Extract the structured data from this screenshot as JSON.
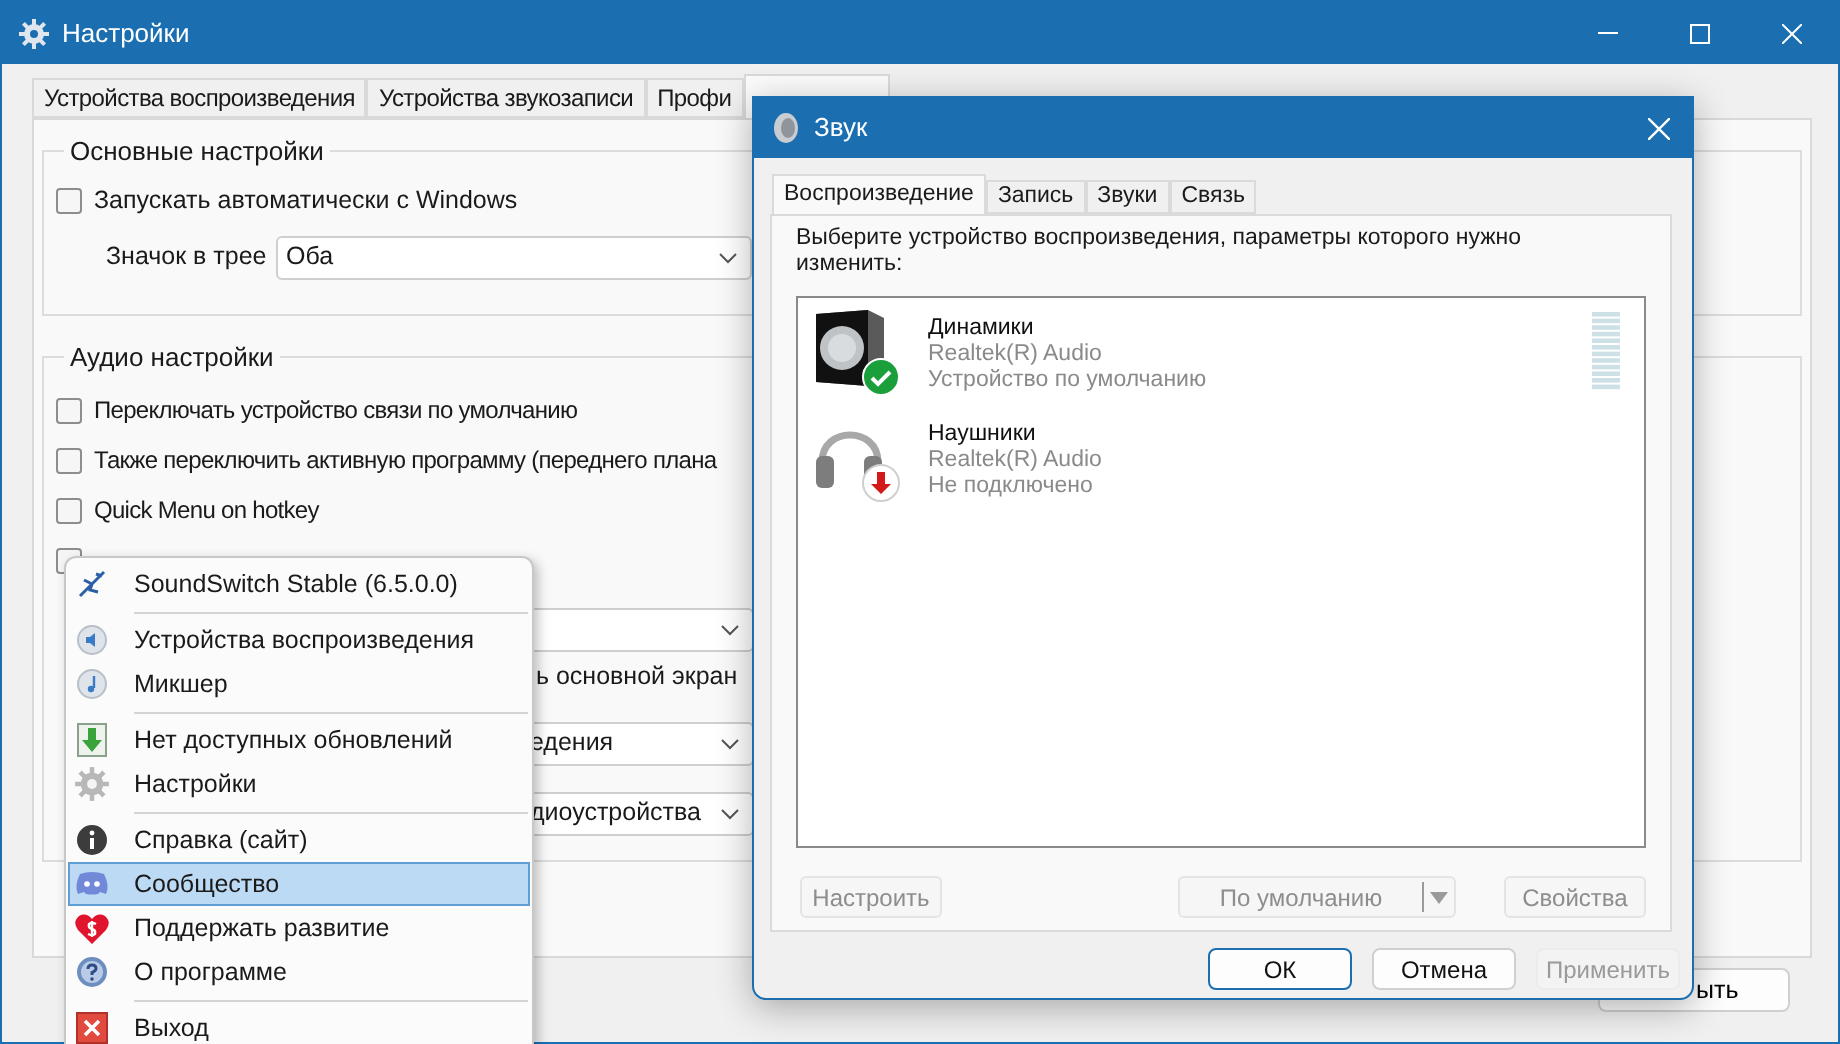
{
  "settings_window": {
    "title": "Настройки",
    "tabs": [
      {
        "label": "Устройства воспроизведения",
        "selected": false
      },
      {
        "label": "Устройства звукозаписи",
        "selected": false
      },
      {
        "label": "Профи",
        "selected": false
      },
      {
        "selected": true
      }
    ],
    "general_group": {
      "title": "Основные настройки",
      "autostart": {
        "label": "Запускать автоматически с Windows",
        "checked": false
      },
      "tray_icon": {
        "label": "Значок в трее",
        "value": "Оба"
      }
    },
    "audio_group": {
      "title": "Аудио настройки",
      "options": [
        {
          "kind": "checkbox",
          "label": "Переключать устройство связи по умолчанию",
          "checked": false
        },
        {
          "kind": "checkbox",
          "label": "Также переключить активную программу (переднего плана",
          "checked": false
        },
        {
          "kind": "checkbox",
          "label": "Quick Menu on hotkey",
          "checked": false
        },
        {
          "kind": "checkbox",
          "checked": false
        },
        {
          "kind": "select"
        },
        {
          "kind": "text",
          "label": "ь основной экран"
        },
        {
          "kind": "select",
          "value": "едения"
        },
        {
          "kind": "select",
          "value": "диоустройства"
        }
      ]
    },
    "close_button": "ыть"
  },
  "sound_window": {
    "title": "Звук",
    "tabs": [
      {
        "label": "Воспроизведение",
        "selected": true
      },
      {
        "label": "Запись",
        "selected": false
      },
      {
        "label": "Звуки",
        "selected": false
      },
      {
        "label": "Связь",
        "selected": false
      }
    ],
    "instruction": "Выберите устройство воспроизведения, параметры которого нужно изменить:",
    "devices": [
      {
        "kind": "speakers",
        "name": "Динамики",
        "driver": "Realtek(R) Audio",
        "status": "Устройство по умолчанию",
        "level": 0
      },
      {
        "kind": "headphones",
        "name": "Наушники",
        "driver": "Realtek(R) Audio",
        "status": "Не подключено"
      }
    ],
    "device_buttons": [
      {
        "kind": "button",
        "label": "Настроить",
        "disabled": true
      },
      {
        "kind": "split",
        "label": "По умолчанию",
        "disabled": true
      },
      {
        "kind": "button",
        "label": "Свойства",
        "disabled": true
      }
    ],
    "dialog_buttons": [
      {
        "label": "ОК",
        "disabled": false,
        "default": true
      },
      {
        "label": "Отмена",
        "disabled": false,
        "default": false
      },
      {
        "label": "Применить",
        "disabled": true,
        "default": false
      }
    ]
  },
  "tray_menu": {
    "items": [
      {
        "kind": "header",
        "label": "SoundSwitch Stable (6.5.0.0)",
        "selected": false
      },
      {
        "kind": "separator"
      },
      {
        "kind": "item",
        "label": "Устройства воспроизведения",
        "selected": false
      },
      {
        "kind": "item",
        "label": "Микшер",
        "selected": false
      },
      {
        "kind": "separator"
      },
      {
        "kind": "item",
        "label": "Нет доступных обновлений",
        "selected": false
      },
      {
        "kind": "item",
        "label": "Настройки",
        "selected": false
      },
      {
        "kind": "separator"
      },
      {
        "kind": "item",
        "label": "Справка (сайт)",
        "selected": false
      },
      {
        "kind": "item",
        "label": "Сообщество",
        "selected": true
      },
      {
        "kind": "item",
        "label": "Поддержать развитие",
        "selected": false
      },
      {
        "kind": "item",
        "label": "О программе",
        "selected": false
      },
      {
        "kind": "separator"
      },
      {
        "kind": "item",
        "label": "Выход",
        "selected": false
      }
    ]
  }
}
